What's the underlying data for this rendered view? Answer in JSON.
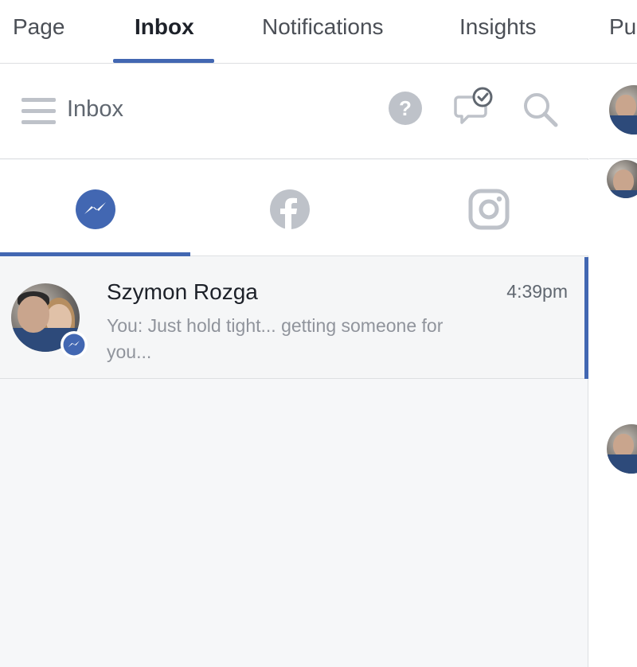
{
  "top_nav": {
    "tabs": [
      {
        "label": "Page"
      },
      {
        "label": "Inbox"
      },
      {
        "label": "Notifications"
      },
      {
        "label": "Insights"
      },
      {
        "label": "Pu"
      }
    ],
    "active": "Inbox"
  },
  "inbox_header": {
    "title": "Inbox",
    "icons": [
      "menu-icon",
      "help-icon",
      "chat-check-icon",
      "search-icon"
    ]
  },
  "platform_tabs": {
    "items": [
      "messenger-icon",
      "facebook-icon",
      "instagram-icon"
    ],
    "active": "messenger-icon"
  },
  "conversations": [
    {
      "name": "Szymon Rozga",
      "time": "4:39pm",
      "snippet": "You: Just hold tight... getting someone for you...",
      "channel_badge": "messenger-icon"
    }
  ],
  "colors": {
    "accent": "#4267b2",
    "icon_gray": "#bec2c9",
    "panel_bg": "#f6f7f9"
  }
}
